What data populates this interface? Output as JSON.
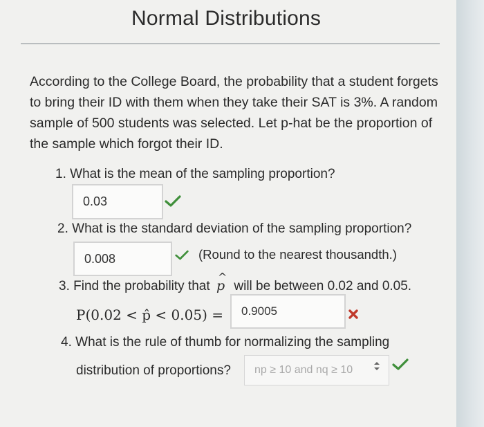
{
  "title": "Normal Distributions",
  "intro": "According to the College Board, the probability that a student forgets to bring their ID with them when they take their SAT is 3%. A random sample of 500 students was selected. Let p-hat be the proportion of the sample which forgot their ID.",
  "questions": [
    {
      "number": "1.",
      "text": "What is the mean of the sampling proportion?",
      "answer": "0.03",
      "status": "correct"
    },
    {
      "number": "2.",
      "text": "What is the standard deviation of the sampling proportion?",
      "answer": "0.008",
      "status": "correct",
      "note": "(Round to the nearest thousandth.)"
    },
    {
      "number": "3.",
      "text_before": "Find the probability that",
      "text_after": "will be between 0.02 and 0.05.",
      "expression": "P(0.02 < p̂ < 0.05) =",
      "answer": "0.9005",
      "status": "incorrect"
    },
    {
      "number": "4.",
      "text": "What is the rule of thumb for normalizing the sampling",
      "text_line2": "distribution of proportions?",
      "selected_option": "np ≥ 10 and nq ≥ 10",
      "status": "correct"
    }
  ],
  "colors": {
    "check": "#3f8f3a",
    "cross": "#c0392b"
  }
}
